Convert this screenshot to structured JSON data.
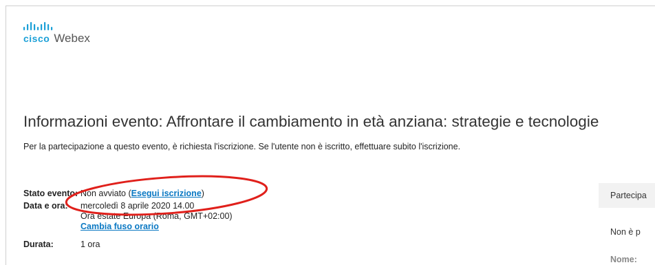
{
  "brand": {
    "cisco": "cisco",
    "product": "Webex",
    "color": "#1ba0d7"
  },
  "event": {
    "title": "Informazioni evento: Affrontare il cambiamento in età anziana: strategie e tecnologie",
    "notice": "Per la partecipazione a questo evento, è richiesta l'iscrizione. Se l'utente non è iscritto, effettuare subito l'iscrizione.",
    "status_label": "Stato evento:",
    "status_value": "Non avviato (",
    "register_link": "Esegui iscrizione",
    "status_close": ")",
    "date_label": "Data e ora:",
    "date_value": "mercoledì 8 aprile 2020 14.00",
    "timezone": "Ora estate Europa (Roma, GMT+02:00)",
    "change_tz_link": "Cambia fuso orario",
    "duration_label": "Durata:",
    "duration_value": "1 ora"
  },
  "side_panel": {
    "title": "Partecipa",
    "notice": "Non è p",
    "name_label": "Nome:"
  },
  "annotation": {
    "color": "#e0201b"
  }
}
